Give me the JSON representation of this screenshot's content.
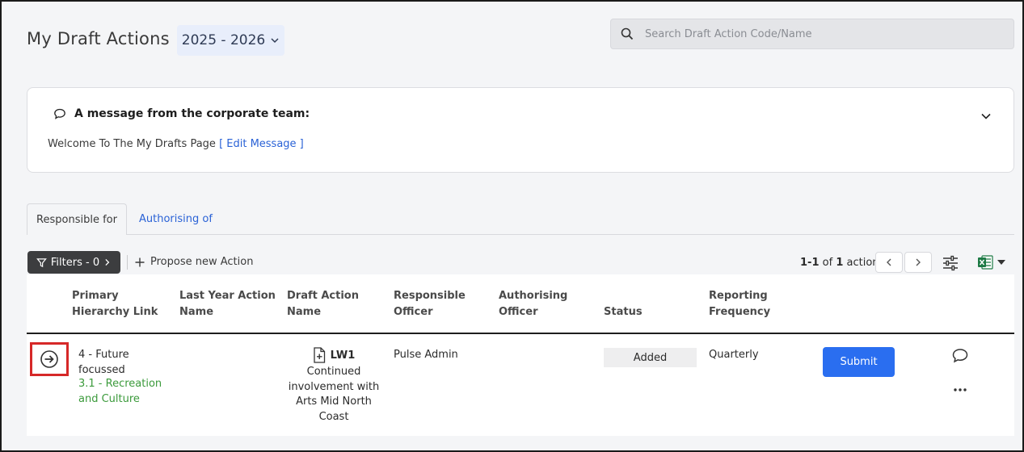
{
  "header": {
    "title": "My Draft Actions",
    "year_selector": "2025 - 2026",
    "search_placeholder": "Search Draft Action Code/Name"
  },
  "message": {
    "heading": "A message from the corporate team:",
    "body": "Welcome To The My Drafts Page",
    "edit_link": "[ Edit Message ]"
  },
  "tabs": [
    {
      "label": "Responsible for",
      "active": true
    },
    {
      "label": "Authorising of",
      "active": false
    }
  ],
  "toolbar": {
    "filters_label": "Filters - 0",
    "propose_label": "Propose new Action",
    "pager_range": "1-1",
    "pager_of": "of",
    "pager_total": "1",
    "pager_unit": "action"
  },
  "table": {
    "columns": [
      "Primary Hierarchy Link",
      "Last Year Action Name",
      "Draft Action Name",
      "Responsible Officer",
      "Authorising Officer",
      "Status",
      "Reporting Frequency"
    ],
    "rows": [
      {
        "hierarchy_primary": "4 - Future focussed",
        "hierarchy_secondary": "3.1 - Recreation and Culture",
        "last_year_action": "",
        "draft_code": "LW1",
        "draft_name": "Continued involvement with Arts Mid North Coast",
        "responsible_officer": "Pulse Admin",
        "authorising_officer": "",
        "status": "Added",
        "reporting_frequency": "Quarterly",
        "submit_label": "Submit"
      }
    ]
  },
  "colors": {
    "accent": "#2a6ef0",
    "link": "#2a62d6",
    "hierarchy_green": "#3b9a3b",
    "highlight_red": "#d62828"
  }
}
